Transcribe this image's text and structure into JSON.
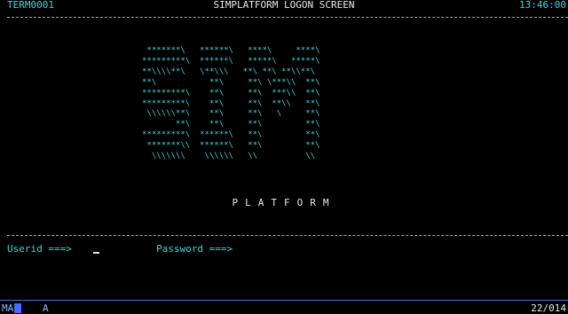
{
  "header": {
    "terminal_id": "TERM0001",
    "title": "SIMPLATFORM LOGON SCREEN",
    "time": "13:46:00"
  },
  "logo": {
    "lines": [
      " *******\\   ******\\   ****\\     ****\\",
      "*********\\  ******\\   *****\\   *****\\",
      "**\\\\\\\\**\\   \\**\\\\\\   **\\ **\\ **\\\\**\\",
      "**\\           **\\     **\\ \\***\\\\  **\\",
      "*********\\    **\\     **\\  ***\\\\  **\\",
      "*********\\    **\\     **\\  **\\\\   **\\",
      " \\\\\\\\\\\\**\\    **\\     **\\   \\     **\\",
      "       **\\    **\\     **\\         **\\",
      "*********\\  ******\\   **\\         **\\",
      " *******\\\\  ******\\   **\\         **\\",
      "  \\\\\\\\\\\\\\    \\\\\\\\\\\\   \\\\          \\\\"
    ]
  },
  "subtitle": "PLATFORM",
  "login": {
    "userid_label": "Userid ===>",
    "userid_value": "",
    "password_label": "Password ===>",
    "password_value": ""
  },
  "status_bar": {
    "mode": "MA",
    "indicator": "A",
    "cursor_position": "22/014"
  },
  "colors": {
    "background": "#000000",
    "text_cyan": "#3fd6d6",
    "text_white": "#e8e8e8",
    "oia_blue": "#4a6cff"
  }
}
